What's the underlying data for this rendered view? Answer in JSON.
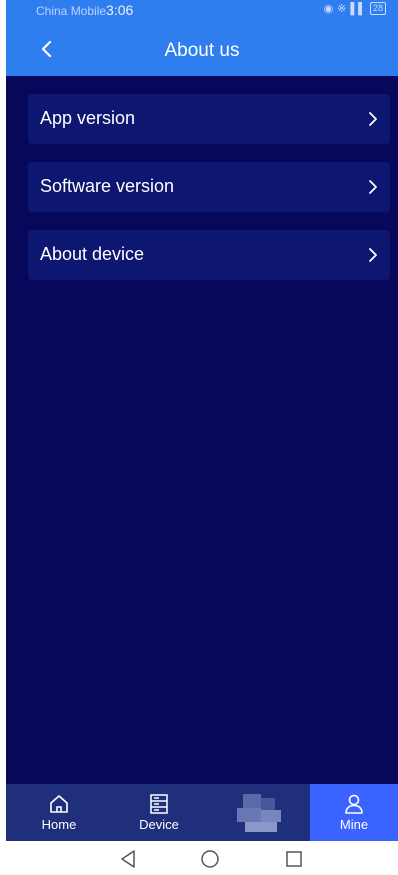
{
  "status_bar": {
    "carrier": "China Mobile",
    "time": "3:06",
    "battery": "28"
  },
  "header": {
    "title": "About us",
    "back_icon": "chevron-left-icon"
  },
  "menu": [
    {
      "label": "App version",
      "icon": "chevron-right-icon"
    },
    {
      "label": "Software version",
      "icon": "chevron-right-icon"
    },
    {
      "label": "About device",
      "icon": "chevron-right-icon"
    }
  ],
  "tabbar": {
    "tabs": [
      {
        "label": "Home",
        "icon": "home-icon",
        "active": false
      },
      {
        "label": "Device",
        "icon": "device-list-icon",
        "active": false
      },
      {
        "label": "",
        "icon": "blurred-icon",
        "active": false
      },
      {
        "label": "Mine",
        "icon": "user-icon",
        "active": true
      }
    ]
  },
  "system_nav": {
    "buttons": [
      "back-triangle-icon",
      "home-circle-icon",
      "recents-square-icon"
    ]
  },
  "colors": {
    "header": "#2f7ef0",
    "background": "#07085a",
    "card": "#0d1670",
    "tabbar": "#1f2f7b",
    "active_tab": "#3a63ff"
  }
}
